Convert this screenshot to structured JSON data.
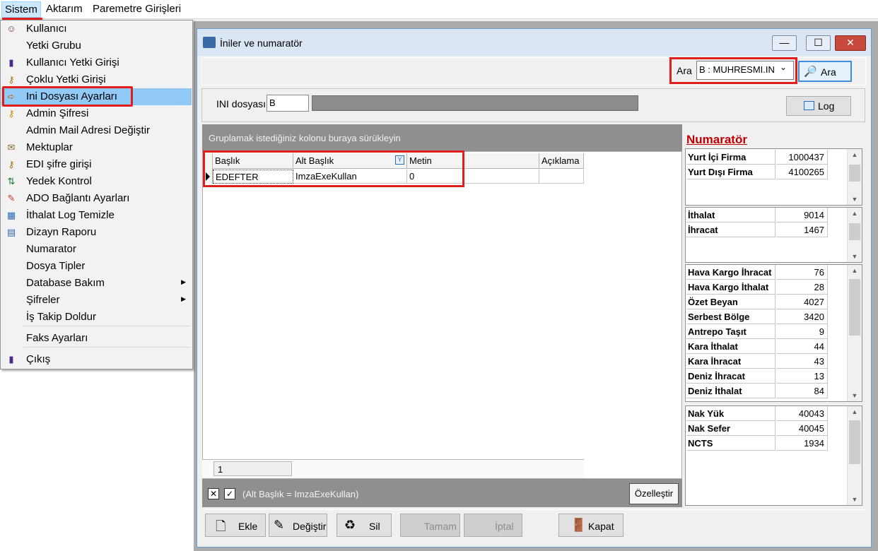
{
  "menubar": {
    "items": [
      "Sistem",
      "Aktarım",
      "Paremetre Girişleri"
    ]
  },
  "dropdown": {
    "items": [
      {
        "label": "Kullanıcı",
        "icon": "user-icon"
      },
      {
        "label": "Yetki Grubu",
        "icon": ""
      },
      {
        "label": "Kullanıcı Yetki Girişi",
        "icon": "user-key-icon"
      },
      {
        "label": "Çoklu Yetki Girişi",
        "icon": "multi-key-icon"
      },
      {
        "label": "Ini Dosyası  Ayarları",
        "icon": "ini-file-icon"
      },
      {
        "label": "Admin Şifresi",
        "icon": "key-icon"
      },
      {
        "label": "Admin Mail Adresi Değiştir",
        "icon": ""
      },
      {
        "label": "Mektuplar",
        "icon": "letter-icon"
      },
      {
        "label": "EDI şifre girişi",
        "icon": "edi-key-icon"
      },
      {
        "label": "Yedek Kontrol",
        "icon": "backup-icon"
      },
      {
        "label": "ADO Bağlantı Ayarları",
        "icon": "connection-icon"
      },
      {
        "label": "İthalat Log Temizle",
        "icon": "log-clean-icon"
      },
      {
        "label": "Dizayn Raporu",
        "icon": "report-icon"
      },
      {
        "label": "Numarator",
        "icon": ""
      },
      {
        "label": "Dosya Tipler",
        "icon": ""
      },
      {
        "label": "Database Bakım",
        "icon": "",
        "submenu": true
      },
      {
        "label": "Şifreler",
        "icon": "",
        "submenu": true
      },
      {
        "label": "İş Takip Doldur",
        "icon": ""
      },
      {
        "label": "Faks Ayarları",
        "icon": ""
      },
      {
        "label": "Çıkış",
        "icon": "exit-icon"
      }
    ]
  },
  "window": {
    "title": "İniler ve numaratör",
    "search": {
      "label": "Ara",
      "combo_value": "B : MUHRESMI.IN",
      "button": "Ara"
    },
    "ini": {
      "label": "INI dosyası",
      "value": "B",
      "log_button": "Log"
    },
    "grid": {
      "group_hint": "Gruplamak istediğiniz kolonu buraya sürükleyin",
      "columns": [
        "Başlık",
        "Alt Başlık",
        "Metin",
        "Açıklama"
      ],
      "rows": [
        [
          "EDEFTER",
          "ImzaExeKullan",
          "0",
          ""
        ]
      ],
      "footer_value": "1",
      "filter_text": "(Alt Başlık = ImzaExeKullan)",
      "customize_button": "Özelleştir"
    },
    "buttons": [
      "Ekle",
      "Değiştir",
      "Sil",
      "Tamam",
      "İptal",
      "Kapat"
    ],
    "numarator": {
      "title": "Numaratör",
      "groups": [
        [
          {
            "k": "Yurt İçi Firma",
            "v": "1000437"
          },
          {
            "k": "Yurt Dışı Firma",
            "v": "4100265"
          }
        ],
        [
          {
            "k": "İthalat",
            "v": "9014"
          },
          {
            "k": "İhracat",
            "v": "1467"
          }
        ],
        [
          {
            "k": "Hava Kargo İhracat",
            "v": "76"
          },
          {
            "k": "Hava Kargo İthalat",
            "v": "28"
          },
          {
            "k": "Özet Beyan",
            "v": "4027"
          },
          {
            "k": "Serbest Bölge",
            "v": "3420"
          },
          {
            "k": "Antrepo Taşıt",
            "v": "9"
          },
          {
            "k": "Kara İthalat",
            "v": "44"
          },
          {
            "k": "Kara İhracat",
            "v": "43"
          },
          {
            "k": "Deniz İhracat",
            "v": "13"
          },
          {
            "k": "Deniz İthalat",
            "v": "84"
          }
        ],
        [
          {
            "k": "Nak Yük",
            "v": "40043"
          },
          {
            "k": "Nak Sefer",
            "v": "40045"
          },
          {
            "k": "NCTS",
            "v": "1934"
          }
        ]
      ]
    }
  }
}
